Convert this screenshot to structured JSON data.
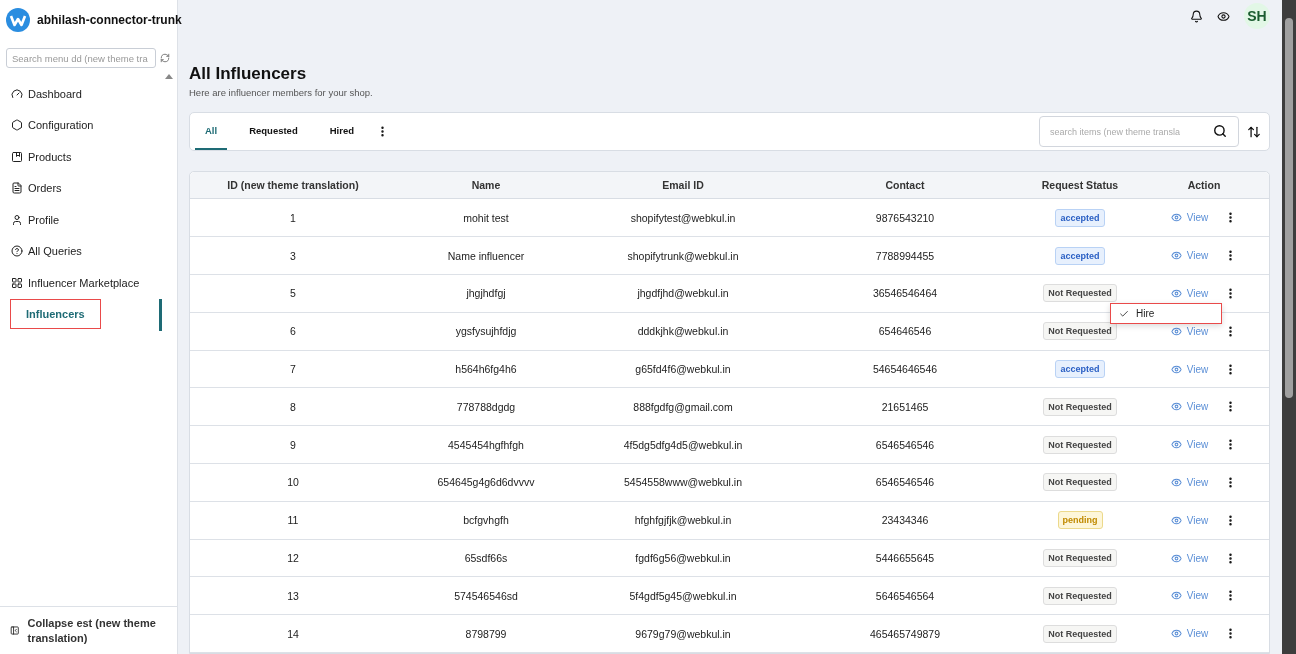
{
  "brand": {
    "title": "abhilash-connector-trunk"
  },
  "sidebar": {
    "search": {
      "placeholder": "Search menu dd (new theme tra"
    },
    "items": [
      {
        "label": "Dashboard",
        "selected": false
      },
      {
        "label": "Configuration",
        "selected": false
      },
      {
        "label": "Products",
        "selected": false
      },
      {
        "label": "Orders",
        "selected": false
      },
      {
        "label": "Profile",
        "selected": false
      },
      {
        "label": "All Queries",
        "selected": false
      },
      {
        "label": "Influencer Marketplace",
        "selected": false
      },
      {
        "label": "Influencers",
        "selected": true
      }
    ],
    "collapse": "Collapse est (new theme translation)"
  },
  "header": {
    "avatar": "SH"
  },
  "page": {
    "title": "All Influencers",
    "subtitle": "Here are influencer members for your shop."
  },
  "tabs": [
    {
      "label": "All",
      "selected": true
    },
    {
      "label": "Requested",
      "selected": false
    },
    {
      "label": "Hired",
      "selected": false
    }
  ],
  "search": {
    "placeholder": "search items (new theme transla"
  },
  "table": {
    "columns": [
      "ID (new theme translation)",
      "Name",
      "Email ID",
      "Contact",
      "Request Status",
      "Action"
    ],
    "rows": [
      {
        "id": "1",
        "name": "mohit test",
        "email": "shopifytest@webkul.in",
        "contact": "9876543210",
        "status": {
          "label": "accepted",
          "kind": "accepted"
        },
        "action": "View"
      },
      {
        "id": "3",
        "name": "Name influencer",
        "email": "shopifytrunk@webkul.in",
        "contact": "7788994455",
        "status": {
          "label": "accepted",
          "kind": "accepted"
        },
        "action": "View"
      },
      {
        "id": "5",
        "name": "jhgjhdfgj",
        "email": "jhgdfjhd@webkul.in",
        "contact": "36546546464",
        "status": {
          "label": "Not Requested",
          "kind": "none"
        },
        "action": "View",
        "menu": [
          {
            "label": "Hire",
            "checked": true
          }
        ]
      },
      {
        "id": "6",
        "name": "ygsfysujhfdjg",
        "email": "dddkjhk@webkul.in",
        "contact": "654646546",
        "status": {
          "label": "Not Requested",
          "kind": "none"
        },
        "action": "View"
      },
      {
        "id": "7",
        "name": "h564h6fg4h6",
        "email": "g65fd4f6@webkul.in",
        "contact": "54654646546",
        "status": {
          "label": "accepted",
          "kind": "accepted"
        },
        "action": "View"
      },
      {
        "id": "8",
        "name": "778788dgdg",
        "email": "888fgdfg@gmail.com",
        "contact": "21651465",
        "status": {
          "label": "Not Requested",
          "kind": "none"
        },
        "action": "View"
      },
      {
        "id": "9",
        "name": "4545454hgfhfgh",
        "email": "4f5dg5dfg4d5@webkul.in",
        "contact": "6546546546",
        "status": {
          "label": "Not Requested",
          "kind": "none"
        },
        "action": "View"
      },
      {
        "id": "10",
        "name": "654645g4g6d6dvvvv",
        "email": "5454558www@webkul.in",
        "contact": "6546546546",
        "status": {
          "label": "Not Requested",
          "kind": "none"
        },
        "action": "View"
      },
      {
        "id": "11",
        "name": "bcfgvhgfh",
        "email": "hfghfgjfjk@webkul.in",
        "contact": "23434346",
        "status": {
          "label": "pending",
          "kind": "pending"
        },
        "action": "View"
      },
      {
        "id": "12",
        "name": "65sdf66s",
        "email": "fgdf6g56@webkul.in",
        "contact": "5446655645",
        "status": {
          "label": "Not Requested",
          "kind": "none"
        },
        "action": "View"
      },
      {
        "id": "13",
        "name": "574546546sd",
        "email": "5f4gdf5g45@webkul.in",
        "contact": "5646546564",
        "status": {
          "label": "Not Requested",
          "kind": "none"
        },
        "action": "View"
      },
      {
        "id": "14",
        "name": "8798799",
        "email": "9679g79@webkul.in",
        "contact": "465465749879",
        "status": {
          "label": "Not Requested",
          "kind": "none"
        },
        "action": "View"
      }
    ]
  }
}
